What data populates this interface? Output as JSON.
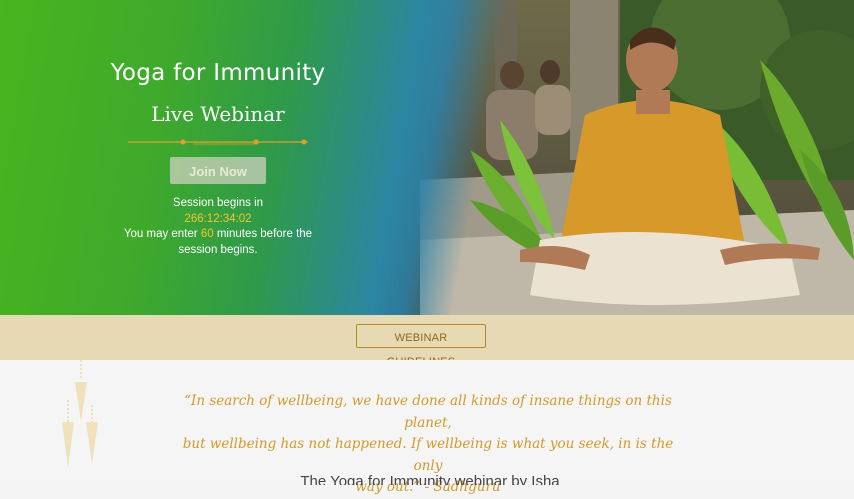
{
  "hero": {
    "title": "Yoga for Immunity",
    "subtitle": "Live Webinar",
    "join_label": "Join Now",
    "session_prefix": "Session begins in",
    "countdown": "266:12:34:02",
    "enter_text_before": "You may enter",
    "enter_minutes": "60",
    "enter_text_after": "minutes before the",
    "enter_text_end": "session begins."
  },
  "guidelines": {
    "label": "WEBINAR GUIDELINES"
  },
  "quote": {
    "line1": "“In search of wellbeing, we have done all kinds of insane things on this planet,",
    "line2": "but wellbeing has not happened. If wellbeing is what you seek, in is the only",
    "line3": "way out.” - Sadhguru"
  },
  "next": {
    "text": "The Yoga for Immunity webinar by Isha"
  },
  "colors": {
    "hero_green": "#47b51d",
    "hero_blue": "#2a86a3",
    "accent_gold": "#d19a2a",
    "countdown_orange": "#f3c238",
    "guidelines_bg": "#e6d9b3"
  }
}
